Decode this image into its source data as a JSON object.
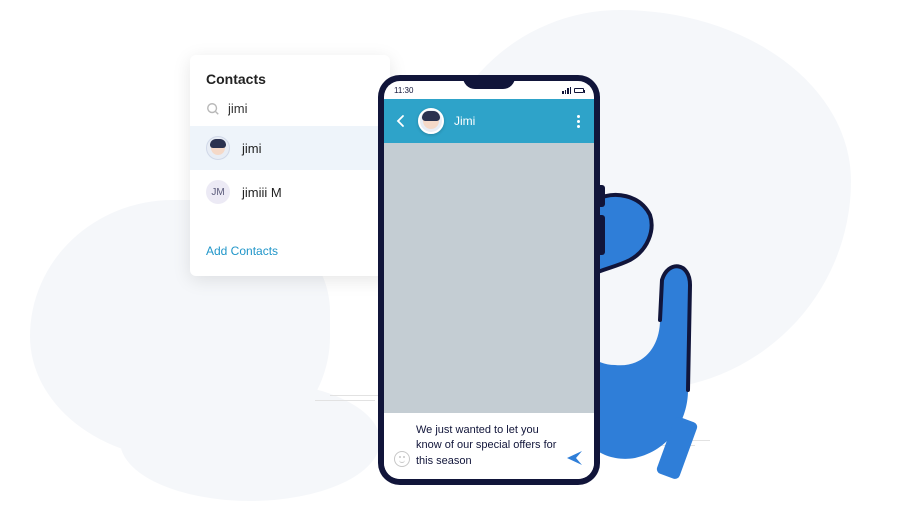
{
  "contacts": {
    "title": "Contacts",
    "search_value": "jimi",
    "items": [
      {
        "name": "jimi",
        "avatar_type": "image",
        "selected": true
      },
      {
        "name": "jimiii M",
        "avatar_type": "initials",
        "initials": "JM",
        "selected": false
      }
    ],
    "add_label": "Add Contacts"
  },
  "phone": {
    "status_time": "11:30",
    "chat": {
      "contact_name": "Jimi",
      "compose_text": "We just wanted to let you know of our special offers for this season"
    }
  },
  "colors": {
    "accent": "#2ea3c9",
    "device_frame": "#11153a",
    "hand_blue": "#2f7ed8"
  }
}
